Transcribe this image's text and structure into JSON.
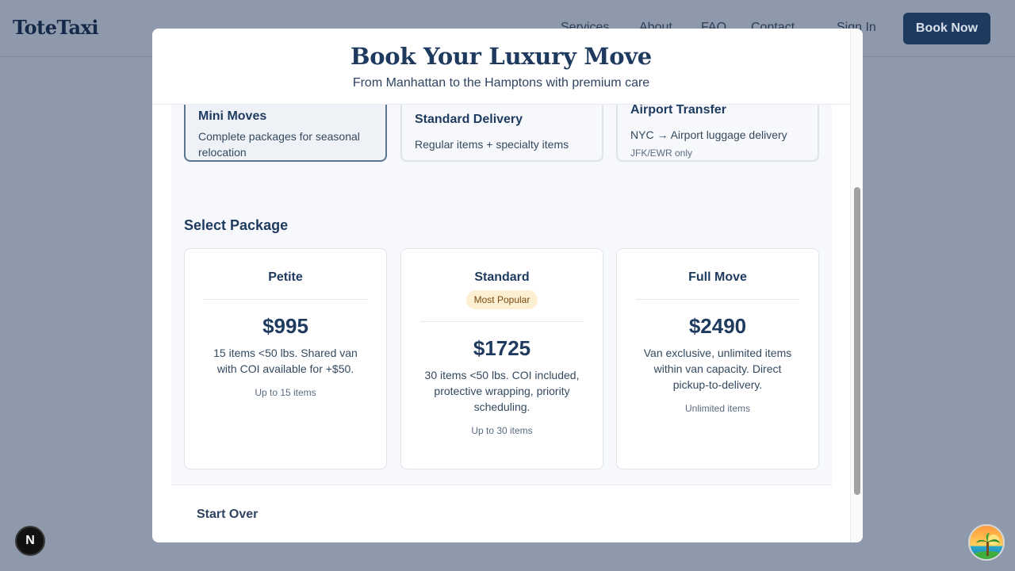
{
  "site": {
    "logo": "ToteTaxi",
    "nav": [
      "Services",
      "About",
      "FAQ",
      "Contact"
    ],
    "sign_in": "Sign In",
    "book_now": "Book Now"
  },
  "modal": {
    "title": "Book Your Luxury Move",
    "subtitle": "From Manhattan to the Hamptons with premium care",
    "services": [
      {
        "title": "Mini Moves",
        "desc": "Complete packages for seasonal relocation",
        "note": "",
        "selected": true
      },
      {
        "title": "Standard Delivery",
        "desc": "Regular items + specialty items",
        "note": "",
        "selected": false
      },
      {
        "title": "Airport Transfer",
        "desc": "NYC → Airport luggage delivery",
        "note": "JFK/EWR only",
        "selected": false
      }
    ],
    "section_title": "Select Package",
    "packages": [
      {
        "name": "Petite",
        "badge": "",
        "price": "$995",
        "desc": "15 items <50 lbs. Shared van with COI available for +$50.",
        "limit": "Up to 15 items"
      },
      {
        "name": "Standard",
        "badge": "Most Popular",
        "price": "$1725",
        "desc": "30 items <50 lbs. COI included, protective wrapping, priority scheduling.",
        "limit": "Up to 30 items"
      },
      {
        "name": "Full Move",
        "badge": "",
        "price": "$2490",
        "desc": "Van exclusive, unlimited items within van capacity. Direct pickup-to-delivery.",
        "limit": "Unlimited items"
      }
    ],
    "start_over": "Start Over"
  },
  "dev_badge": "N",
  "colors": {
    "primary": "#1e3a5f",
    "overlay": "#8e9aab",
    "badge_bg": "#fdf0d2",
    "disabled_button": "#94a3b8"
  },
  "icons": {
    "dev_indicator": "nextjs-logo-icon",
    "avatar": "beach-avatar-icon"
  }
}
